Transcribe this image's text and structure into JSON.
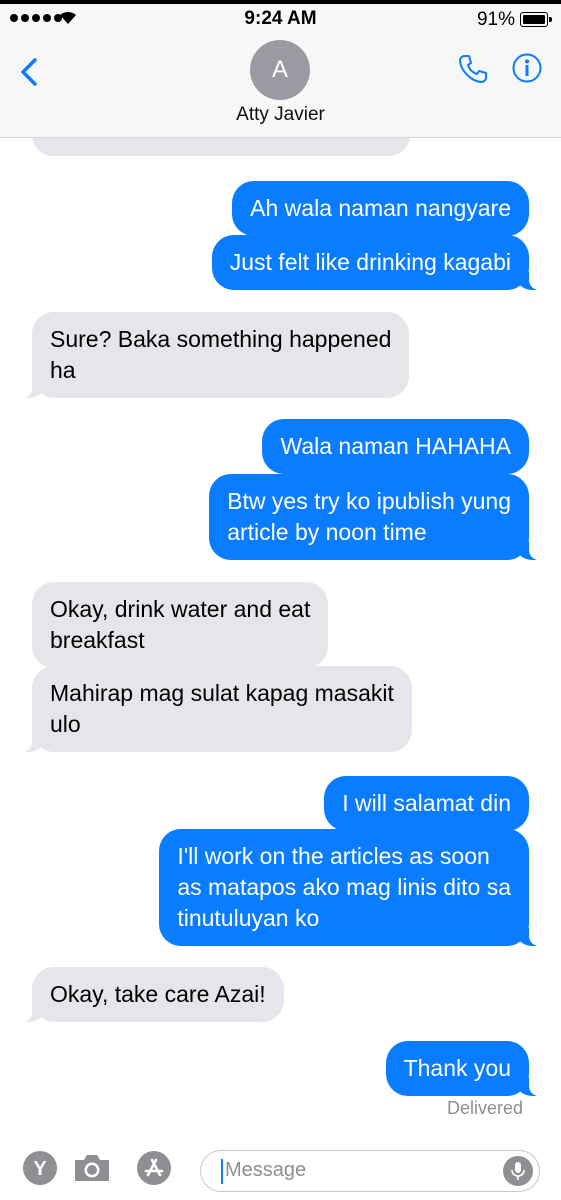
{
  "status": {
    "time": "9:24 AM",
    "battery": "91%",
    "battery_level": 0.91
  },
  "header": {
    "avatar_initial": "A",
    "contact_name": "Atty Javier"
  },
  "messages": [
    {
      "dir": "in",
      "text": "Sure? Baka something happened\nha"
    },
    {
      "dir": "out",
      "text": "Ah wala naman nangyare"
    },
    {
      "dir": "out",
      "text": "Just felt like drinking kagabi"
    },
    {
      "dir": "out",
      "text": "Wala naman HAHAHA"
    },
    {
      "dir": "out",
      "text": "Btw yes try ko ipublish yung\narticle by noon time"
    },
    {
      "dir": "in",
      "text": "Okay, drink water and eat\nbreakfast"
    },
    {
      "dir": "in",
      "text": "Mahirap mag sulat kapag masakit\nulo"
    },
    {
      "dir": "out",
      "text": "I will salamat din"
    },
    {
      "dir": "out",
      "text": "I'll work on the articles as soon\nas matapos ako mag linis dito sa\ntinutuluyan ko"
    },
    {
      "dir": "in",
      "text": "Okay, take care Azai!"
    },
    {
      "dir": "out",
      "text": "Thank you"
    }
  ],
  "delivered_label": "Delivered",
  "compose": {
    "placeholder": "Message"
  },
  "app_icons": [
    "yelp-icon",
    "camera-icon",
    "app-store-icon"
  ],
  "colors": {
    "outgoing": "#0a7cff",
    "incoming": "#e5e5ea",
    "accent": "#0a7cff"
  }
}
